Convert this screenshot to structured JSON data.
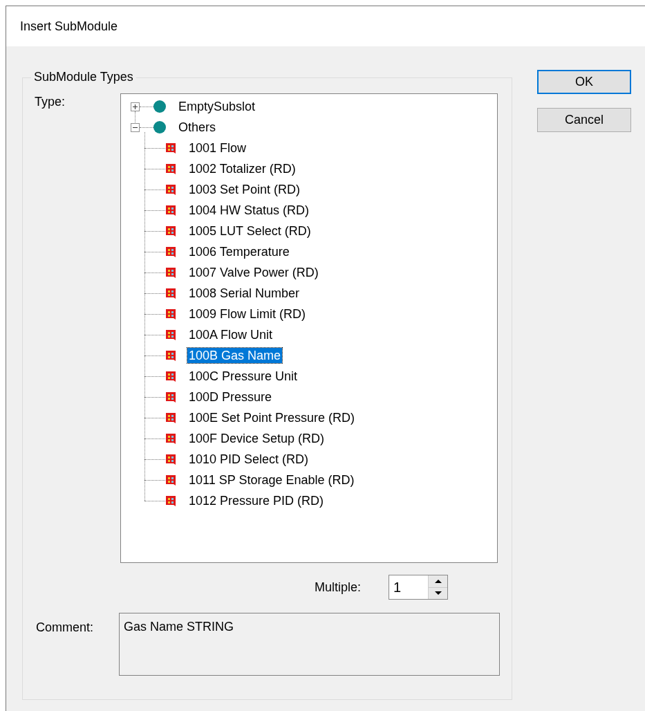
{
  "window": {
    "title": "Insert SubModule"
  },
  "group": {
    "title": "SubModule Types"
  },
  "type_label": "Type:",
  "tree": [
    {
      "label": "EmptySubslot",
      "kind": "group",
      "expanded": false,
      "selected": false
    },
    {
      "label": "Others",
      "kind": "group",
      "expanded": true,
      "selected": false,
      "children": [
        {
          "label": "1001 Flow",
          "kind": "module",
          "selected": false
        },
        {
          "label": "1002 Totalizer (RD)",
          "kind": "module",
          "selected": false
        },
        {
          "label": "1003 Set Point (RD)",
          "kind": "module",
          "selected": false
        },
        {
          "label": "1004 HW Status (RD)",
          "kind": "module",
          "selected": false
        },
        {
          "label": "1005 LUT Select (RD)",
          "kind": "module",
          "selected": false
        },
        {
          "label": "1006 Temperature",
          "kind": "module",
          "selected": false
        },
        {
          "label": "1007 Valve Power (RD)",
          "kind": "module",
          "selected": false
        },
        {
          "label": "1008 Serial Number",
          "kind": "module",
          "selected": false
        },
        {
          "label": "1009 Flow Limit (RD)",
          "kind": "module",
          "selected": false
        },
        {
          "label": "100A Flow Unit",
          "kind": "module",
          "selected": false
        },
        {
          "label": "100B Gas Name",
          "kind": "module",
          "selected": true
        },
        {
          "label": "100C Pressure Unit",
          "kind": "module",
          "selected": false
        },
        {
          "label": "100D Pressure",
          "kind": "module",
          "selected": false
        },
        {
          "label": "100E Set Point Pressure (RD)",
          "kind": "module",
          "selected": false
        },
        {
          "label": "100F Device Setup (RD)",
          "kind": "module",
          "selected": false
        },
        {
          "label": "1010 PID Select (RD)",
          "kind": "module",
          "selected": false
        },
        {
          "label": "1011 SP Storage Enable (RD)",
          "kind": "module",
          "selected": false
        },
        {
          "label": "1012 Pressure PID (RD)",
          "kind": "module",
          "selected": false
        }
      ]
    }
  ],
  "multiple": {
    "label": "Multiple:",
    "value": "1"
  },
  "comment": {
    "label": "Comment:",
    "value": "Gas Name STRING"
  },
  "buttons": [
    {
      "label": "OK",
      "default": true
    },
    {
      "label": "Cancel",
      "default": false
    }
  ]
}
